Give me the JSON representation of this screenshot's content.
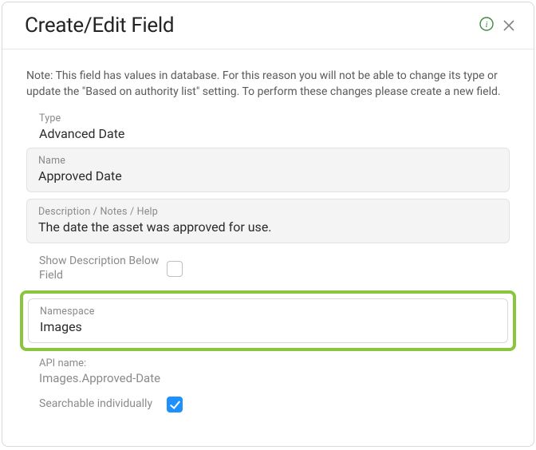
{
  "header": {
    "title": "Create/Edit Field"
  },
  "note": "Note: This field has values in database. For this reason you will not be able to change its type or update the \"Based on authority list\" setting. To perform these changes please create a new field.",
  "type": {
    "label": "Type",
    "value": "Advanced Date"
  },
  "name": {
    "label": "Name",
    "value": "Approved Date"
  },
  "description": {
    "label": "Description / Notes / Help",
    "value": "The date the asset was approved for use."
  },
  "show_description": {
    "label": "Show Description Below Field",
    "checked": false
  },
  "namespace": {
    "label": "Namespace",
    "value": "Images"
  },
  "api": {
    "label": "API name:",
    "value": "Images.Approved-Date"
  },
  "searchable": {
    "label": "Searchable individually",
    "checked": true
  }
}
